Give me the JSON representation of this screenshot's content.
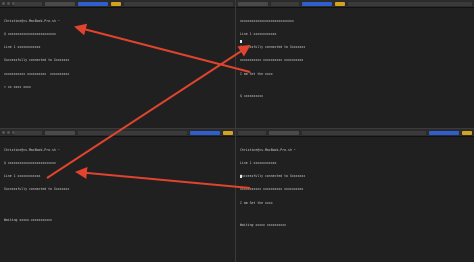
{
  "panes": {
    "top_left": {
      "lines": [
        "Christine@cs-MacBook-Pro-sh ~",
        "$ xxxxxxxxxxxxxxxxxxxxxxxxx",
        "Line 1 xxxxxxxxxxxx",
        "Successfully connected to Xxxxxxxx",
        "xxxxxxxxxxx xxxxxxxxxx  xxxxxxxxxx",
        "> xx xxxx xxxx"
      ]
    },
    "top_right": {
      "lines": [
        "xxxxxxxxxxxxxxxxxxxxxxxxxxxx",
        "Line 1 xxxxxxxxxxxx",
        "Successfully connected to Xxxxxxxx",
        "xxxxxxxxxxx xxxxxxxxxx xxxxxxxxxx",
        "I am Set the xxxx",
        "",
        "$ xxxxxxxxxx"
      ]
    },
    "bottom_left": {
      "lines": [
        "Christine@cs-MacBook-Pro-sh ~",
        "$ xxxxxxxxxxxxxxxxxxxxxxxxx",
        "Line 1 xxxxxxxxxxxx",
        "Successfully connected to Xxxxxxxx",
        "",
        "",
        "Waiting xxxxx.xxxxxxxxxxx"
      ]
    },
    "bottom_right": {
      "lines": [
        "Christine@cs-MacBook-Pro-sh ~",
        "Line 1 xxxxxxxxxxxx",
        "Successfully connected to Xxxxxxxx",
        "xxxxxxxxxxx xxxxxxxxxx xxxxxxxxxx",
        "I am Set the xxxx",
        "",
        "Waiting xxxxx xxxxxxxxxx"
      ]
    }
  },
  "colors": {
    "arrow": "#e0442e",
    "accent_tab": "#2f5fcf",
    "accent_yellow": "#d3a21f"
  }
}
